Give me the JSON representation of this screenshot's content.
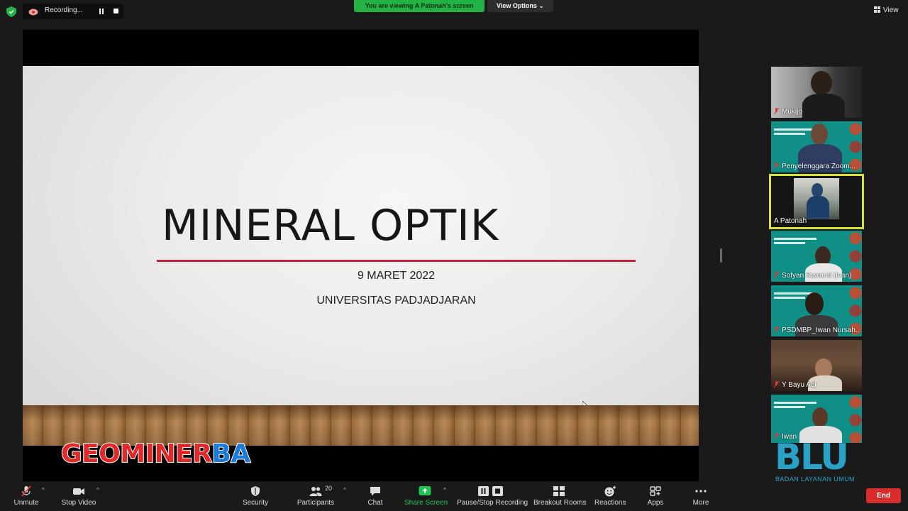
{
  "top": {
    "recording_label": "Recording...",
    "viewing_banner": "You are viewing A Patonah's screen",
    "view_options": "View Options ⌄",
    "view_label": "View"
  },
  "slide": {
    "title": "MINERAL OPTIK",
    "date": "9 MARET 2022",
    "university": "UNIVERSITAS PADJADJARAN"
  },
  "overlays": {
    "brand_geo": "GEO",
    "brand_miner": "MINER",
    "brand_ba": "BA",
    "blu_logo": "BLU",
    "blu_sub": "BADAN LAYANAN UMUM"
  },
  "participants": [
    {
      "name": "Mukijo"
    },
    {
      "name": "Penyelenggara Zoom..."
    },
    {
      "name": "A Patonah"
    },
    {
      "name": "Sofyan Suwardi (Ivan)"
    },
    {
      "name": "PSDMBP_Iwan Nursah..."
    },
    {
      "name": "Y Bayu Adi"
    },
    {
      "name": "Iwan"
    }
  ],
  "toolbar": {
    "unmute": "Unmute",
    "stop_video": "Stop Video",
    "security": "Security",
    "participants": "Participants",
    "participants_count": "20",
    "chat": "Chat",
    "share_screen": "Share Screen",
    "pause_stop": "Pause/Stop Recording",
    "breakout": "Breakout Rooms",
    "reactions": "Reactions",
    "apps": "Apps",
    "more": "More",
    "end": "End"
  },
  "colors": {
    "accent_green": "#23b345",
    "end_red": "#d92c2c",
    "active_speaker": "#d6df3b",
    "slide_line": "#c2213d"
  },
  "icons": [
    "shield-icon",
    "cloud-record-icon",
    "pause-icon",
    "stop-icon",
    "grid-icon",
    "mic-muted-icon",
    "video-icon",
    "security-icon",
    "participants-icon",
    "chat-icon",
    "share-screen-icon",
    "pause-stop-icon",
    "breakout-icon",
    "reactions-icon",
    "apps-icon",
    "more-icon"
  ]
}
